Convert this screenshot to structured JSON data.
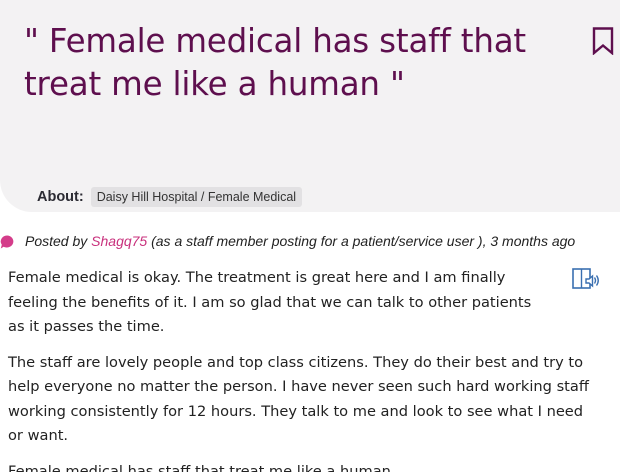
{
  "story": {
    "title_open_quote": "\"",
    "title": "Female medical has staff that treat me like a human",
    "title_close_quote": "\"",
    "about_label": "About:",
    "about_tag": "Daisy Hill Hospital / Female Medical",
    "meta": {
      "posted_by": "Posted by",
      "author": "Shagq75",
      "role": "(as  a staff member posting for a patient/service user )",
      "time": ", 3 months ago"
    },
    "paragraphs": [
      "Female medical is okay. The treatment is great here and I am finally feeling the benefits of it. I am so glad that we can talk to other patients as it passes the time.",
      "The staff are lovely people and top class citizens. They do their best and try to help everyone no matter the person. I have never seen such hard working staff working consistently for 12 hours. They talk to me and look to see what I need or want.",
      "Female medical has staff that treat me like a human."
    ]
  },
  "icons": {
    "bookmark": "bookmark-icon",
    "speech_bubble": "speech-bubble-icon",
    "listen": "listen-audio-icon"
  },
  "colors": {
    "title": "#5e0f4e",
    "author_link": "#c8307c",
    "bubble": "#d43d8a",
    "header_bg": "#f3f2f3",
    "tag_bg": "#e2e1e3"
  }
}
